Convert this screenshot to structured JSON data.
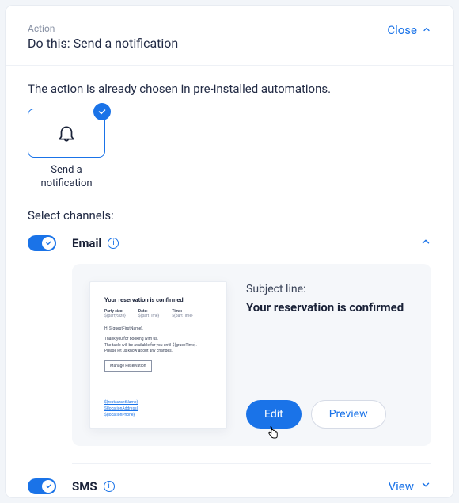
{
  "header": {
    "eyebrow": "Action",
    "title": "Do this: Send a notification",
    "close_label": "Close"
  },
  "intro": "The action is already chosen in pre-installed automations.",
  "tile": {
    "caption": "Send a notification"
  },
  "channels_label": "Select channels:",
  "email": {
    "name": "Email",
    "subject_label": "Subject line:",
    "subject": "Your reservation is confirmed",
    "edit_label": "Edit",
    "preview_label": "Preview",
    "thumb": {
      "title": "Your reservation is confirmed",
      "cols": [
        {
          "label": "Party size:",
          "value": "${partySize}"
        },
        {
          "label": "Date:",
          "value": "${partTime}"
        },
        {
          "label": "Time:",
          "value": "${partTime}"
        }
      ],
      "greeting": "Hi ${guestFirstName},",
      "body1": "Thank you for booking with us.",
      "body2": "The table will be available for you until ${graceTime}.",
      "body3": "Please let us know about any changes.",
      "button": "Manage Reservation",
      "footer": [
        "${restaurantName}",
        "${locationAddress}",
        "${locationPhone}"
      ]
    }
  },
  "sms": {
    "name": "SMS",
    "view_label": "View"
  }
}
